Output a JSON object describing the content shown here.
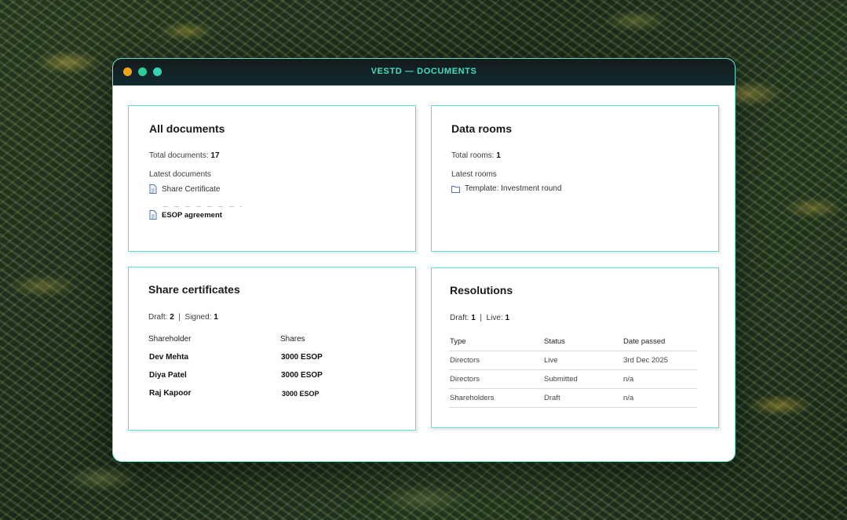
{
  "window": {
    "title": "VESTD — DOCUMENTS"
  },
  "all_documents": {
    "title": "All documents",
    "total_label": "Total documents:",
    "total_value": "17",
    "latest_label": "Latest documents",
    "items": [
      "Share Certificate",
      "ESOP agreement"
    ]
  },
  "data_rooms": {
    "title": "Data rooms",
    "total_label": "Total rooms:",
    "total_value": "1",
    "latest_label": "Latest rooms",
    "items": [
      "Template: Investment round"
    ]
  },
  "share_certificates": {
    "title": "Share certificates",
    "draft_label": "Draft:",
    "draft_value": "2",
    "separator": "|",
    "signed_label": "Signed:",
    "signed_value": "1",
    "columns": [
      "Shareholder",
      "Shares"
    ],
    "rows": [
      {
        "shareholder": "Dev Mehta",
        "shares": "3000 ESOP"
      },
      {
        "shareholder": "Diya Patel",
        "shares": "3000 ESOP"
      },
      {
        "shareholder": "Raj Kapoor",
        "shares": "3000 ESOP"
      }
    ]
  },
  "resolutions": {
    "title": "Resolutions",
    "draft_label": "Draft:",
    "draft_value": "1",
    "separator": "|",
    "live_label": "Live:",
    "live_value": "1",
    "columns": [
      "Type",
      "Status",
      "Date passed"
    ],
    "rows": [
      {
        "type": "Directors",
        "status": "Live",
        "date": "3rd Dec 2025"
      },
      {
        "type": "Directors",
        "status": "Submitted",
        "date": "n/a"
      },
      {
        "type": "Shareholders",
        "status": "Draft",
        "date": "n/a"
      }
    ]
  },
  "colors": {
    "accent": "#52e2cc",
    "titlebar": "#121a1c",
    "traffic_yellow": "#f0a614",
    "traffic_green": "#2ecc9a"
  }
}
